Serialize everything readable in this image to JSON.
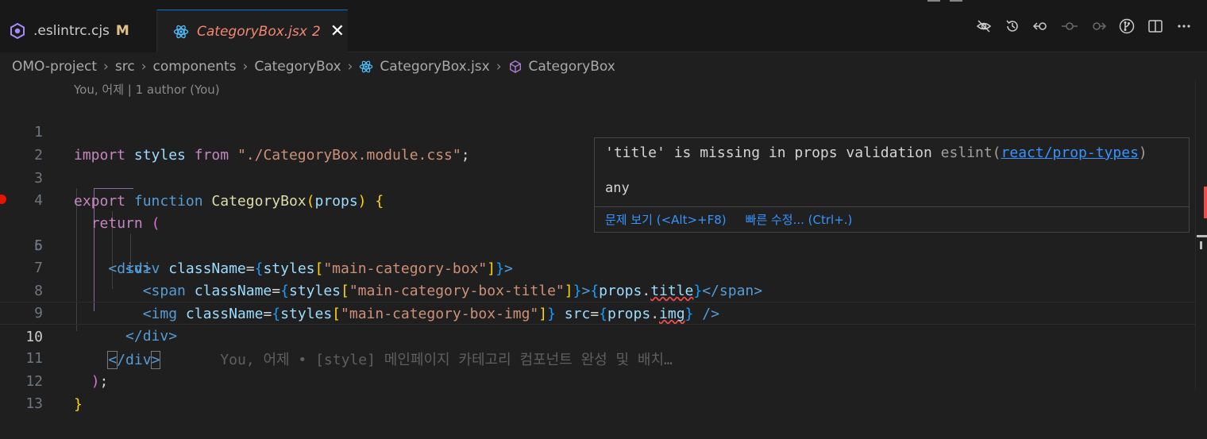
{
  "tabs": [
    {
      "label": ".eslintrc.cjs",
      "status": "M",
      "icon": "eslint-icon"
    },
    {
      "label": "CategoryBox.jsx",
      "count": "2",
      "icon": "react-icon",
      "close": "✕"
    }
  ],
  "breadcrumb": [
    "OMO-project",
    "src",
    "components",
    "CategoryBox",
    "CategoryBox.jsx",
    "CategoryBox"
  ],
  "blame_header": "You, 어제 | 1 author (You)",
  "code": {
    "l1": {
      "kw1": "import",
      "id": "styles",
      "kw2": "from",
      "str": "\"./CategoryBox.module.css\"",
      "end": ";"
    },
    "l4": {
      "kw1": "export",
      "kw2": "function",
      "fn": "CategoryBox",
      "open": "(",
      "param": "props",
      "close": ")",
      "brace": "{"
    },
    "l5": {
      "kw": "return",
      "paren": "("
    },
    "l6": {
      "tag": "<div>"
    },
    "l7": {
      "tag": "<div",
      "attr": "className",
      "eq": "=",
      "ob": "{",
      "id": "styles",
      "lb": "[",
      "str": "\"main-category-box\"",
      "rb": "]",
      "cb": "}",
      "gt": ">"
    },
    "l8": {
      "tag": "<span",
      "attr": "className",
      "eq": "=",
      "ob": "{",
      "id": "styles",
      "lb": "[",
      "str": "\"main-category-box-title\"",
      "rb": "]",
      "cb": "}",
      "gt": ">",
      "ob2": "{",
      "obj": "props",
      "dot": ".",
      "prop": "title",
      "cb2": "}",
      "endtag": "</span>"
    },
    "l9": {
      "tag": "<img",
      "attr": "className",
      "eq": "=",
      "ob": "{",
      "id": "styles",
      "lb": "[",
      "str": "\"main-category-box-img\"",
      "rb": "]",
      "cb": "}",
      "attr2": "src",
      "eq2": "=",
      "ob2": "{",
      "obj": "props",
      "dot": ".",
      "prop": "img",
      "cb2": "}",
      "end": "/>"
    },
    "l10": {
      "endtag": "</div>"
    },
    "l11": {
      "lt": "<",
      "endtag": "/div",
      "gt": ">",
      "ghost": "You, 어제 • [style] 메인페이지 카테고리 컴포넌트 완성 및 배치…"
    },
    "l12": {
      "paren": ")",
      "semi": ";"
    },
    "l13": {
      "brace": "}"
    }
  },
  "line_numbers": [
    "1",
    "2",
    "3",
    "4",
    "5",
    "6",
    "7",
    "8",
    "9",
    "10",
    "11",
    "12",
    "13"
  ],
  "hover": {
    "message": "'title' is missing in props validation",
    "source": "eslint(",
    "rule": "react/prop-types",
    "source_end": ")",
    "type": "any",
    "view_problem": "문제 보기 (<Alt>+F8)",
    "quick_fix": "빠른 수정... (Ctrl+.)"
  },
  "colors": {
    "accent": "#0078d4",
    "error": "#f14c4c",
    "modified": "#e2c08d"
  }
}
